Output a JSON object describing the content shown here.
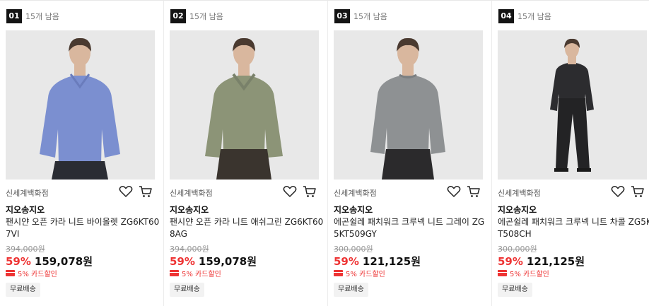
{
  "products": [
    {
      "rank": "01",
      "remaining": "15개 남음",
      "store": "신세계백화점",
      "brand": "지오송지오",
      "name": "팬시얀 오픈 카라 니트 바이올렛 ZG6KT607VI",
      "original_price": "394,000원",
      "discount_rate": "59%",
      "sale_price": "159,078원",
      "card_discount": "5% 카드할인",
      "shipping": "무료배송",
      "garment_color": "#7b8fd0",
      "pants_color": "#2a2c33"
    },
    {
      "rank": "02",
      "remaining": "15개 남음",
      "store": "신세계백화점",
      "brand": "지오송지오",
      "name": "팬시얀 오픈 카라 니트 애쉬그린 ZG6KT608AG",
      "original_price": "394,000원",
      "discount_rate": "59%",
      "sale_price": "159,078원",
      "card_discount": "5% 카드할인",
      "shipping": "무료배송",
      "garment_color": "#8c9477",
      "pants_color": "#3a342e"
    },
    {
      "rank": "03",
      "remaining": "15개 남음",
      "store": "신세계백화점",
      "brand": "지오송지오",
      "name": "에곤쉴레 패치워크 크루넥 니트 그레이 ZG5KT509GY",
      "original_price": "300,000원",
      "discount_rate": "59%",
      "sale_price": "121,125원",
      "card_discount": "5% 카드할인",
      "shipping": "무료배송",
      "garment_color": "#8e9193",
      "pants_color": "#2b2a2c"
    },
    {
      "rank": "04",
      "remaining": "15개 남음",
      "store": "신세계백화점",
      "brand": "지오송지오",
      "name": "에곤쉴레 패치워크 크루넥 니트 차콜 ZG5KT508CH",
      "original_price": "300,000원",
      "discount_rate": "59%",
      "sale_price": "121,125원",
      "card_discount": "5% 카드할인",
      "shipping": "무료배송",
      "garment_color": "#2c2c2f",
      "pants_color": "#232325"
    }
  ],
  "colors": {
    "accent_red": "#ee3333",
    "rank_badge_bg": "#141414",
    "photo_bg": "#e8e8e8"
  },
  "icons": {
    "wishlist": "heart-outline-icon",
    "cart": "shopping-cart-icon",
    "card": "credit-card-icon"
  }
}
